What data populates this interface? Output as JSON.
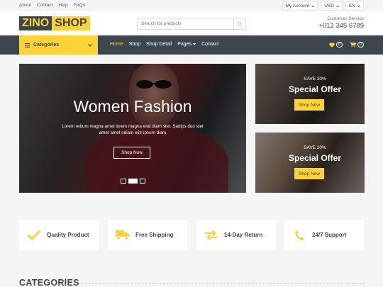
{
  "topbar": {
    "links": [
      "About",
      "Contact",
      "Help",
      "FAQs"
    ],
    "account": "My Account",
    "currency": "USD",
    "language": "EN"
  },
  "header": {
    "logo_part1": "ZINO",
    "logo_part2": "SHOP",
    "search_placeholder": "Search for products",
    "service_label": "Customer Service",
    "service_phone": "+012 345 6789"
  },
  "nav": {
    "categories_label": "Categories",
    "items": [
      "Home",
      "Shop",
      "Shop Detail",
      "Pages",
      "Contact"
    ],
    "active_item": "Home",
    "wishlist_count": "0",
    "cart_count": "0"
  },
  "hero": {
    "title": "Women Fashion",
    "text": "Lorem rebum magna amet lorem magna erat diam stet. Sadips duo stet amet amet ndiam elitr ipsum diam",
    "button": "Shop Now",
    "slide_count": 3,
    "active_slide": 2
  },
  "offers": [
    {
      "save": "SAVE 20%",
      "title": "Special Offer",
      "button": "Shop Now"
    },
    {
      "save": "SAVE 20%",
      "title": "Special Offer",
      "button": "Shop Now"
    }
  ],
  "features": [
    {
      "label": "Quality Product",
      "icon": "check-icon"
    },
    {
      "label": "Free Shipping",
      "icon": "truck-icon"
    },
    {
      "label": "14-Day Return",
      "icon": "exchange-icon"
    },
    {
      "label": "24/7 Support",
      "icon": "phone-icon"
    }
  ],
  "section": {
    "categories_title": "CATEGORIES"
  },
  "colors": {
    "accent": "#FFD333",
    "dark": "#3D464D",
    "background": "#F5F5F5"
  }
}
